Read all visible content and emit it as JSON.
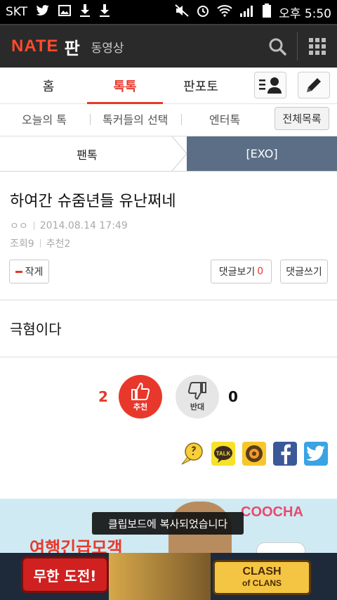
{
  "status_bar": {
    "carrier": "SKT",
    "time": "오후 5:50"
  },
  "app_header": {
    "logo": "NATE",
    "service": "판",
    "video_link": "동영상"
  },
  "main_tabs": [
    {
      "label": "홈"
    },
    {
      "label": "톡톡",
      "active": true
    },
    {
      "label": "판포토"
    }
  ],
  "sub_nav": {
    "items": [
      "오늘의 톡",
      "톡커들의 선택",
      "엔터톡"
    ],
    "all_list_label": "전체목록"
  },
  "breadcrumb": {
    "category": "팬톡",
    "board": "[EXO]"
  },
  "post": {
    "title": "하여간 슈줌년들 유난쩌네",
    "author": "ㅇㅇ",
    "date": "2014.08.14 17:49",
    "views_label": "조회",
    "views": "9",
    "recommend_label": "추천",
    "recommend": "2",
    "author_btn_label": "작게",
    "view_comments_label": "댓글보기",
    "comment_count": "0",
    "write_comment_label": "댓글쓰기",
    "body": "극혐이다"
  },
  "votes": {
    "recommend_count": "2",
    "recommend_label": "추천",
    "oppose_label": "반대",
    "oppose_count": "0"
  },
  "share": {
    "talk_label": "TALK"
  },
  "ad": {
    "brand": "COOCHA",
    "headline": "여행긴급모객"
  },
  "toast": "클립보드에 복사되었습니다",
  "banner": {
    "button": "무한 도전!",
    "game_logo_line1": "CLASH",
    "game_logo_line2": "of CLANS"
  }
}
